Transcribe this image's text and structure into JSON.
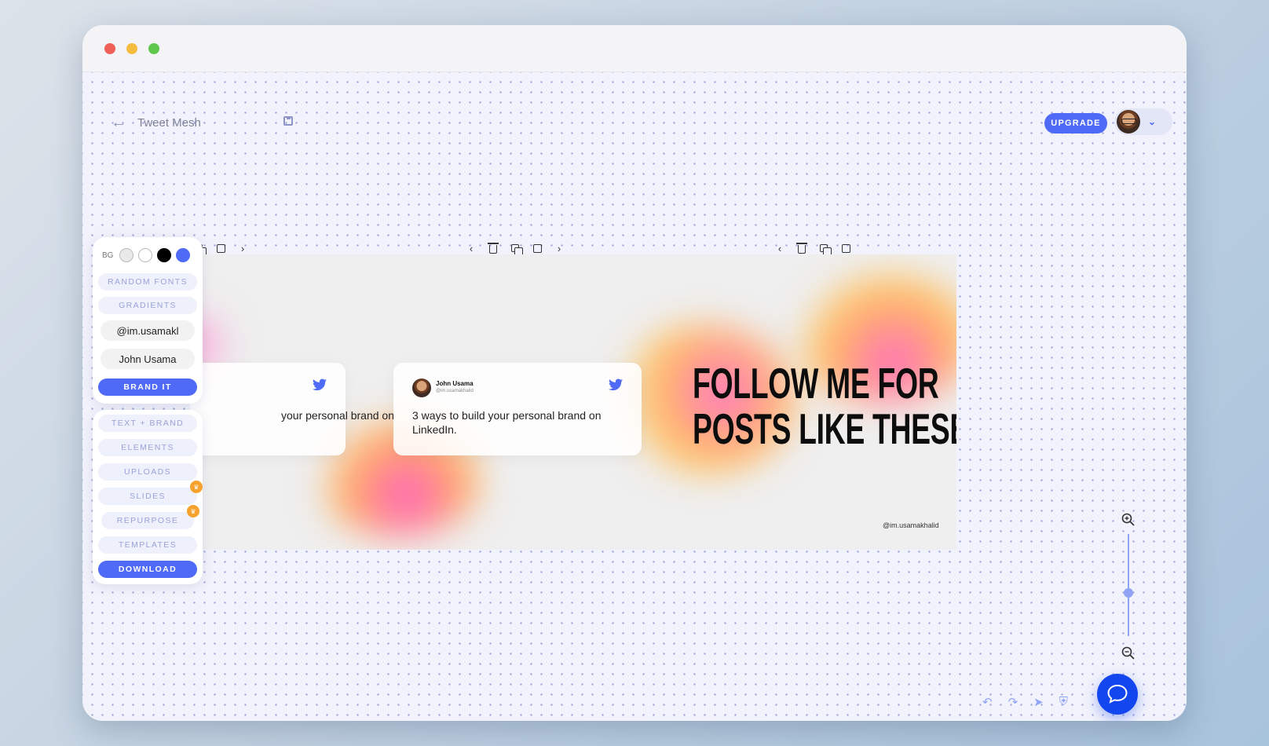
{
  "header": {
    "doc_title": "Tweet Mesh",
    "upgrade_label": "UPGRADE"
  },
  "panel": {
    "bg_label": "BG",
    "swatches": [
      "#e9e9e9",
      "#ffffff",
      "#000000",
      "#4f6af6"
    ],
    "random_fonts": "RANDOM FONTS",
    "gradients": "GRADIENTS",
    "handle_value": "@im.usamakl",
    "name_value": "John Usama",
    "brand_it": "BRAND IT",
    "text_brand": "TEXT + BRAND",
    "elements": "ELEMENTS",
    "uploads": "UPLOADS",
    "slides": "SLIDES",
    "repurpose": "REPURPOSE",
    "templates": "TEMPLATES",
    "download": "DOWNLOAD"
  },
  "tweets": [
    {
      "text": "your personal brand on"
    },
    {
      "name": "John Usama",
      "handle": "@im.usamakhalid",
      "text": "3 ways to build your personal brand on LinkedIn."
    }
  ],
  "slide": {
    "headline_line1": "FOLLOW ME FOR",
    "headline_line2": "POSTS LIKE THESE.",
    "handle": "@im.usamakhalid"
  },
  "colors": {
    "accent": "#4f6af6",
    "chat": "#1446f0",
    "premium": "#f6a22c"
  },
  "zoom": {
    "level": 0.5
  }
}
